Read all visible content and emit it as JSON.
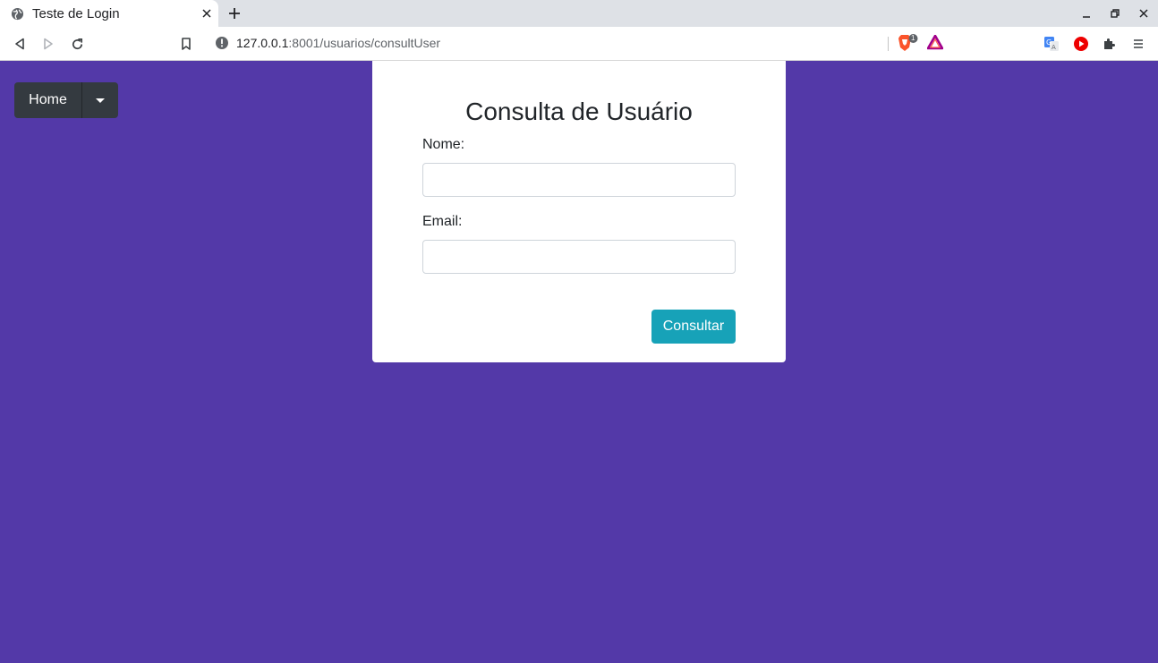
{
  "browser": {
    "tab_title": "Teste de Login",
    "url_host": "127.0.0.1",
    "url_rest": ":8001/usuarios/consultUser",
    "brave_badge": "1"
  },
  "nav": {
    "home_label": "Home"
  },
  "form": {
    "title": "Consulta de Usuário",
    "name_label": "Nome:",
    "name_value": "",
    "email_label": "Email:",
    "email_value": "",
    "submit_label": "Consultar"
  },
  "colors": {
    "page_bg": "#5339a8",
    "dark_button": "#343a40",
    "submit_button": "#17a2b8"
  }
}
